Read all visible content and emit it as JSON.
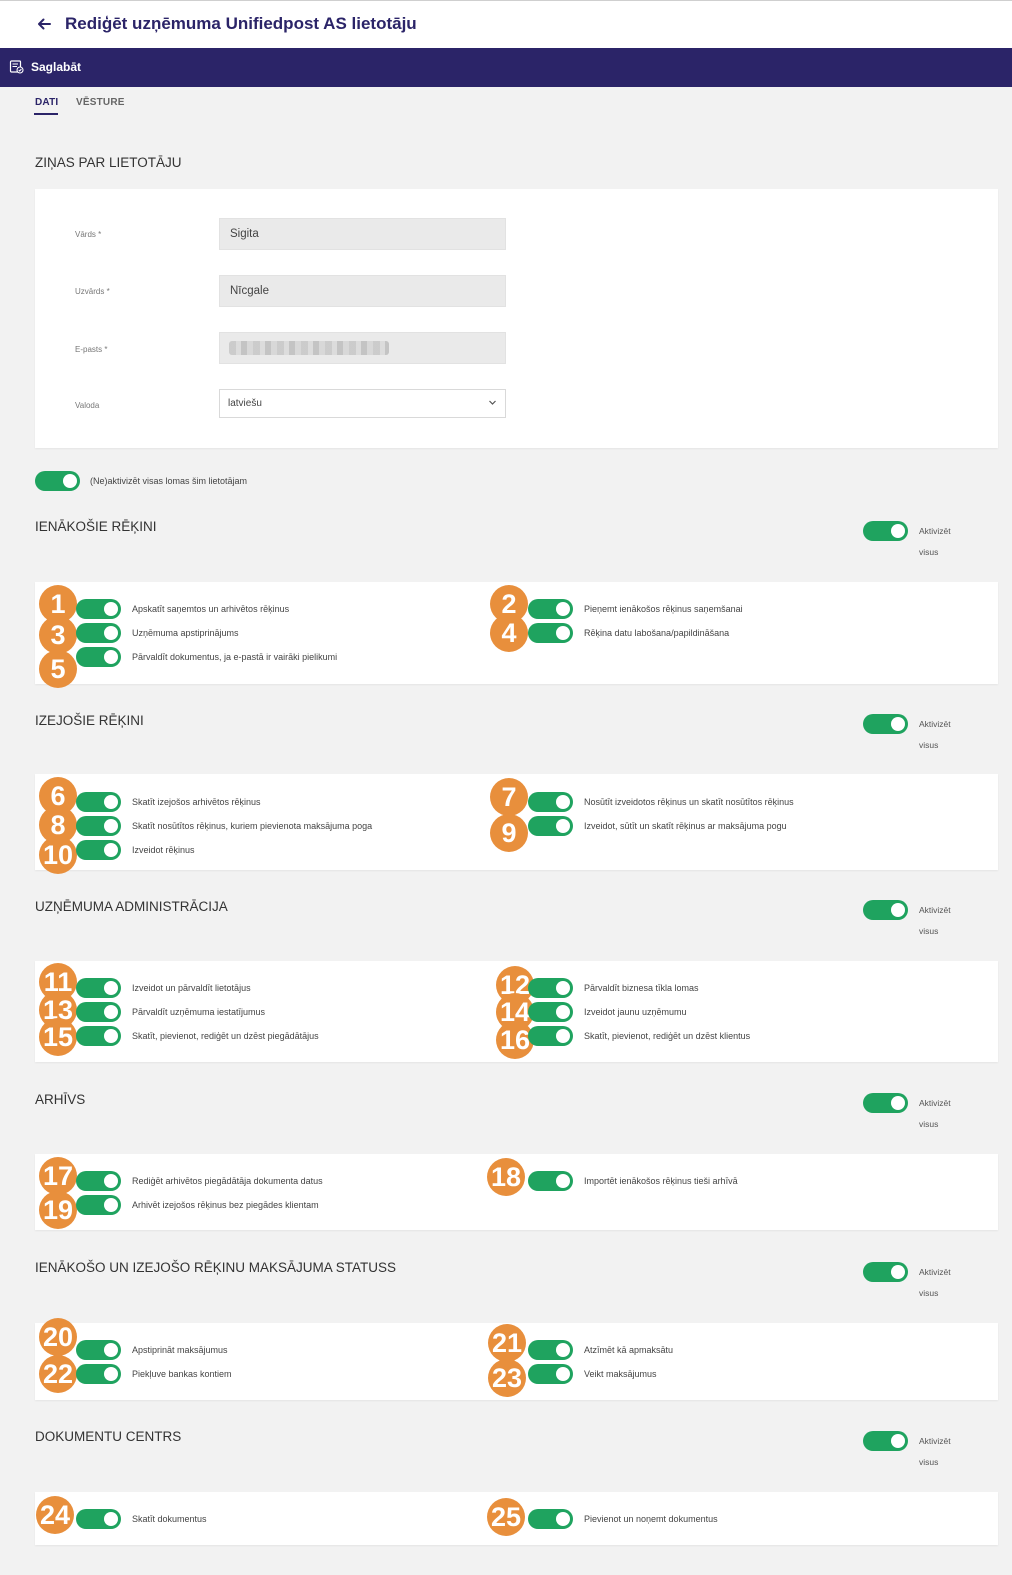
{
  "header": {
    "title": "Rediģēt uzņēmuma Unifiedpost AS lietotāju",
    "back_icon": "arrow-left-icon"
  },
  "toolbar": {
    "save_label": "Saglabāt",
    "save_icon": "save-icon"
  },
  "tabs": [
    {
      "label": "DATI",
      "active": true
    },
    {
      "label": "VĒSTURE",
      "active": false
    }
  ],
  "user_info": {
    "title": "ZIŅAS PAR LIETOTĀJU",
    "fields": [
      {
        "label": "Vārds *",
        "value": "Sigita"
      },
      {
        "label": "Uzvārds *",
        "value": "Nīcgale"
      },
      {
        "label": "E-pasts *",
        "value": ""
      },
      {
        "label": "Valoda",
        "value": "latviešu"
      }
    ]
  },
  "deactivate_all_label": "(Ne)aktivizēt visas lomas šim lietotājam",
  "activate_all_label": "Aktivizēt visus",
  "colors": {
    "primary": "#2b2468",
    "toggle_on": "#1fa35f",
    "badge": "#e88f3c"
  },
  "sections": [
    {
      "title": "IENĀKOŠIE RĒĶINI",
      "items": [
        {
          "n": "1",
          "label": "Apskatīt saņemtos un arhivētos rēķinus",
          "on": true
        },
        {
          "n": "2",
          "label": "Pieņemt ienākošos rēķinus saņemšanai",
          "on": true
        },
        {
          "n": "3",
          "label": "Uzņēmuma apstiprinājums",
          "on": true
        },
        {
          "n": "4",
          "label": "Rēķina datu labošana/papildināšana",
          "on": true
        },
        {
          "n": "5",
          "label": "Pārvaldīt dokumentus, ja e-pastā ir vairāki pielikumi",
          "on": true
        }
      ]
    },
    {
      "title": "IZEJOŠIE RĒĶINI",
      "items": [
        {
          "n": "6",
          "label": "Skatīt izejošos arhivētos rēķinus",
          "on": true
        },
        {
          "n": "7",
          "label": "Nosūtīt izveidotos rēķinus un skatīt nosūtītos rēķinus",
          "on": true
        },
        {
          "n": "8",
          "label": "Skatīt nosūtītos rēķinus, kuriem pievienota maksājuma poga",
          "on": true
        },
        {
          "n": "9",
          "label": "Izveidot, sūtīt un skatīt rēķinus ar maksājuma pogu",
          "on": true
        },
        {
          "n": "10",
          "label": "Izveidot rēķinus",
          "on": true
        }
      ]
    },
    {
      "title": "UZŅĒMUMA ADMINISTRĀCIJA",
      "items": [
        {
          "n": "11",
          "label": "Izveidot un pārvaldīt lietotājus",
          "on": true
        },
        {
          "n": "12",
          "label": "Pārvaldīt biznesa tīkla lomas",
          "on": true
        },
        {
          "n": "13",
          "label": "Pārvaldīt uzņēmuma iestatījumus",
          "on": true
        },
        {
          "n": "14",
          "label": "Izveidot jaunu uzņēmumu",
          "on": true
        },
        {
          "n": "15",
          "label": "Skatīt, pievienot, rediģēt un dzēst piegādātājus",
          "on": true
        },
        {
          "n": "16",
          "label": "Skatīt, pievienot, rediģēt un dzēst klientus",
          "on": true
        }
      ]
    },
    {
      "title": "ARHĪVS",
      "items": [
        {
          "n": "17",
          "label": "Rediģēt arhivētos piegādātāja dokumenta datus",
          "on": true
        },
        {
          "n": "18",
          "label": "Importēt ienākošos rēķinus tieši arhīvā",
          "on": true
        },
        {
          "n": "19",
          "label": "Arhivēt izejošos rēķinus bez piegādes klientam",
          "on": true
        }
      ]
    },
    {
      "title": "IENĀKOŠO UN IZEJOŠO RĒĶINU MAKSĀJUMA STATUSS",
      "items": [
        {
          "n": "20",
          "label": "Apstiprināt maksājumus",
          "on": true
        },
        {
          "n": "21",
          "label": "Atzīmēt kā apmaksātu",
          "on": true
        },
        {
          "n": "22",
          "label": "Piekļuve bankas kontiem",
          "on": true
        },
        {
          "n": "23",
          "label": "Veikt maksājumus",
          "on": true
        }
      ]
    },
    {
      "title": "DOKUMENTU CENTRS",
      "items": [
        {
          "n": "24",
          "label": "Skatīt dokumentus",
          "on": true
        },
        {
          "n": "25",
          "label": "Pievienot un noņemt dokumentus",
          "on": true
        }
      ]
    }
  ]
}
